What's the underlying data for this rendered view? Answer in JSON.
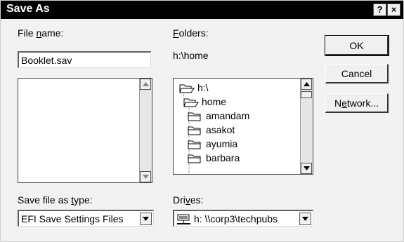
{
  "window": {
    "title": "Save As",
    "help_button": "?",
    "close_button": "×"
  },
  "file_name": {
    "label_pre": "File ",
    "label_key": "n",
    "label_post": "ame:",
    "value": "Booklet.sav"
  },
  "folders": {
    "label_key": "F",
    "label_post": "olders:",
    "current_path": "h:\\home",
    "tree": [
      {
        "label": "h:\\",
        "icon": "open-folder-icon"
      },
      {
        "label": "home",
        "icon": "open-folder-icon"
      },
      {
        "label": "amandam",
        "icon": "folder-icon"
      },
      {
        "label": "asakot",
        "icon": "folder-icon"
      },
      {
        "label": "ayumia",
        "icon": "folder-icon"
      },
      {
        "label": "barbara",
        "icon": "folder-icon"
      }
    ]
  },
  "save_type": {
    "label_pre": "Save file as ",
    "label_key": "t",
    "label_post": "ype:",
    "value": "EFI Save Settings Files"
  },
  "drives": {
    "label_pre": "Dri",
    "label_key": "v",
    "label_post": "es:",
    "value": "h: \\\\corp3\\techpubs",
    "icon": "network-drive-icon"
  },
  "buttons": {
    "ok": "OK",
    "cancel": "Cancel",
    "network_pre": "N",
    "network_key": "e",
    "network_post": "twork..."
  }
}
